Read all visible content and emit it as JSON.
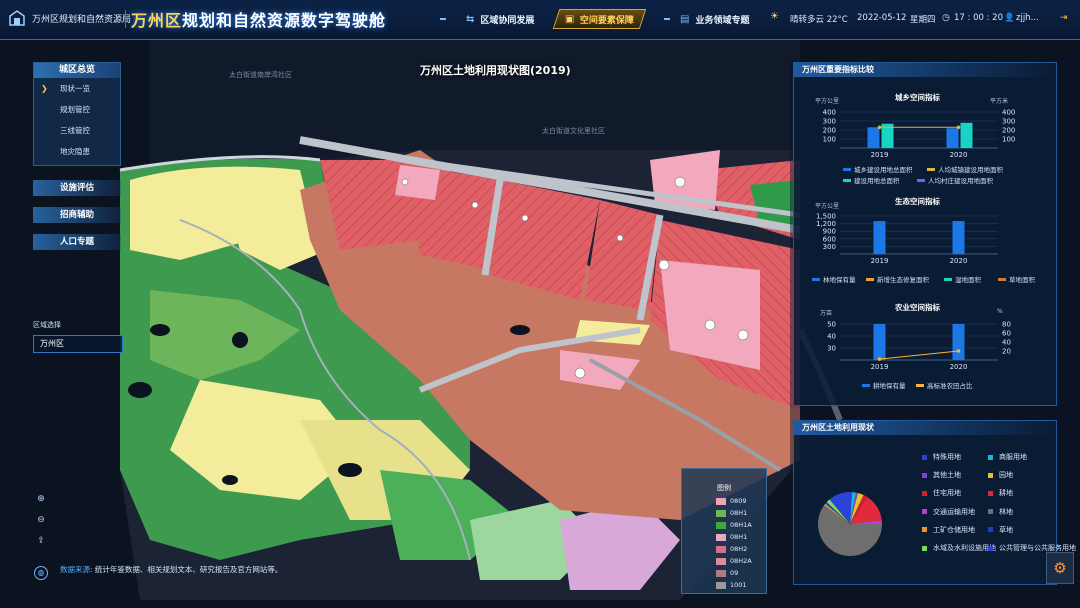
{
  "header": {
    "org": "万州区规划和自然资源局",
    "title_accent": "万州区",
    "title_rest": "规划和自然资源数字驾驶舱",
    "nav": [
      {
        "label": "区域协同发展",
        "icon": "network-icon"
      },
      {
        "label": "空间要素保障",
        "icon": "cube-icon"
      },
      {
        "label": "业务领域专题",
        "icon": "layers-icon"
      }
    ],
    "weather": "晴转多云 22°C",
    "date": "2022-05-12",
    "weekday": "星期四",
    "time": "17 : 00 : 20",
    "user": "zjjh..."
  },
  "left_menu": {
    "head": "城区总览",
    "items": [
      "现状一览",
      "规划管控",
      "三线管控",
      "地灾隐患"
    ],
    "buttons": [
      "设施评估",
      "招商辅助",
      "人口专题"
    ]
  },
  "region": {
    "label": "区域选择",
    "value": "万州区"
  },
  "source": {
    "label": "数据来源:",
    "text": "统计年鉴数据、相关规划文本、研究报告及官方网站等。"
  },
  "map": {
    "title": "万州区土地利用现状图(2019)",
    "labels": [
      "太白街道南岸湾社区",
      "太白街道文化里社区",
      "太白街道南岸湾社区",
      "太白街道南岸湾社区"
    ]
  },
  "legend": {
    "title": "图例",
    "items": [
      {
        "code": "0809",
        "color": "#f0a3b5"
      },
      {
        "code": "08H1",
        "color": "#6fb64f"
      },
      {
        "code": "08H1A",
        "color": "#3fa640"
      },
      {
        "code": "08H1",
        "color": "#e8a8c0"
      },
      {
        "code": "08H2",
        "color": "#d56f8a"
      },
      {
        "code": "08H2A",
        "color": "#d98c9a"
      },
      {
        "code": "09",
        "color": "#b07a82"
      },
      {
        "code": "1001",
        "color": "#9a9a9a"
      }
    ]
  },
  "panel_indicators": {
    "title": "万州区重要指标比较",
    "urban": {
      "title": "城乡空间指标",
      "unit_left": "平方公里",
      "unit_right": "平方米",
      "ticks_left": [
        "400",
        "300",
        "200",
        "100"
      ],
      "ticks_right": [
        "400",
        "300",
        "200",
        "100"
      ],
      "years": [
        "2019",
        "2020"
      ],
      "legend": [
        "城乡建设用地总面积",
        "人均城镇建设用地面积",
        "建设用地总面积",
        "人均村庄建设用地面积"
      ],
      "colors": [
        "#1c78e6",
        "#d9b54a",
        "#19d3c5",
        "#7b5cff"
      ]
    },
    "eco": {
      "title": "生态空间指标",
      "unit": "平方公里",
      "ticks": [
        "1,500",
        "1,200",
        "900",
        "600",
        "300"
      ],
      "years": [
        "2019",
        "2020"
      ],
      "legend": [
        "林地保有量",
        "新增生态修复面积",
        "湿地面积",
        "草地面积"
      ],
      "colors": [
        "#1c78e6",
        "#f0a030",
        "#19d3c5",
        "#d07a3a"
      ]
    },
    "agri": {
      "title": "农业空间指标",
      "unit_left": "万亩",
      "unit_right": "%",
      "ticks_right": [
        "80",
        "60",
        "40",
        "20"
      ],
      "ticks_left": [
        "50",
        "40",
        "30"
      ],
      "years": [
        "2019",
        "2020"
      ],
      "legend": [
        "耕地保有量",
        "高标准农田占比"
      ],
      "colors": [
        "#1c78e6",
        "#ffb13b"
      ]
    }
  },
  "chart_data": [
    {
      "type": "bar",
      "title": "城乡空间指标",
      "categories": [
        "2019",
        "2020"
      ],
      "ylim": [
        0,
        400
      ],
      "series": [
        {
          "name": "城乡建设用地总面积",
          "values": [
            230,
            220
          ]
        },
        {
          "name": "建设用地总面积",
          "values": [
            270,
            280
          ]
        },
        {
          "name": "人均城镇建设用地面积",
          "values": [
            230,
            230
          ]
        },
        {
          "name": "人均村庄建设用地面积",
          "values": [
            220,
            220
          ]
        }
      ]
    },
    {
      "type": "bar",
      "title": "生态空间指标",
      "categories": [
        "2019",
        "2020"
      ],
      "ylim": [
        0,
        1500
      ],
      "series": [
        {
          "name": "林地保有量",
          "values": [
            1300,
            1300
          ]
        },
        {
          "name": "新增生态修复面积",
          "values": [
            0,
            0
          ]
        },
        {
          "name": "湿地面积",
          "values": [
            0,
            0
          ]
        },
        {
          "name": "草地面积",
          "values": [
            0,
            0
          ]
        }
      ]
    },
    {
      "type": "bar",
      "title": "农业空间指标",
      "categories": [
        "2019",
        "2020"
      ],
      "series": [
        {
          "name": "耕地保有量",
          "values": [
            50,
            50
          ]
        },
        {
          "name": "高标准农田占比",
          "values": [
            2,
            20
          ]
        }
      ]
    },
    {
      "type": "pie",
      "title": "万州区土地利用现状",
      "labels": [
        "特殊用地",
        "商服用地",
        "其他土地",
        "园地",
        "住宅用地",
        "耕地",
        "交通运输用地",
        "林地",
        "工矿仓储用地",
        "草地",
        "水域及水利设施用地",
        "公共管理与公共服务用地"
      ],
      "values": [
        1,
        2,
        1,
        3,
        2,
        14,
        2,
        60,
        1,
        1,
        2,
        11
      ]
    }
  ],
  "panel_landuse": {
    "title": "万州区土地利用现状",
    "items": [
      {
        "label": "特殊用地",
        "color": "#2a3fd6"
      },
      {
        "label": "商服用地",
        "color": "#19b8d6"
      },
      {
        "label": "其他土地",
        "color": "#8a3dd1"
      },
      {
        "label": "园地",
        "color": "#e8c02c"
      },
      {
        "label": "住宅用地",
        "color": "#d2202a"
      },
      {
        "label": "耕地",
        "color": "#e02a3e"
      },
      {
        "label": "交通运输用地",
        "color": "#c23bc6"
      },
      {
        "label": "林地",
        "color": "#6e6e6e"
      },
      {
        "label": "工矿仓储用地",
        "color": "#e69a28"
      },
      {
        "label": "草地",
        "color": "#1f3bd1"
      },
      {
        "label": "水域及水利设施用地",
        "color": "#7ddc5a"
      },
      {
        "label": "公共管理与公共服务用地",
        "color": "#2c43d8"
      }
    ]
  }
}
